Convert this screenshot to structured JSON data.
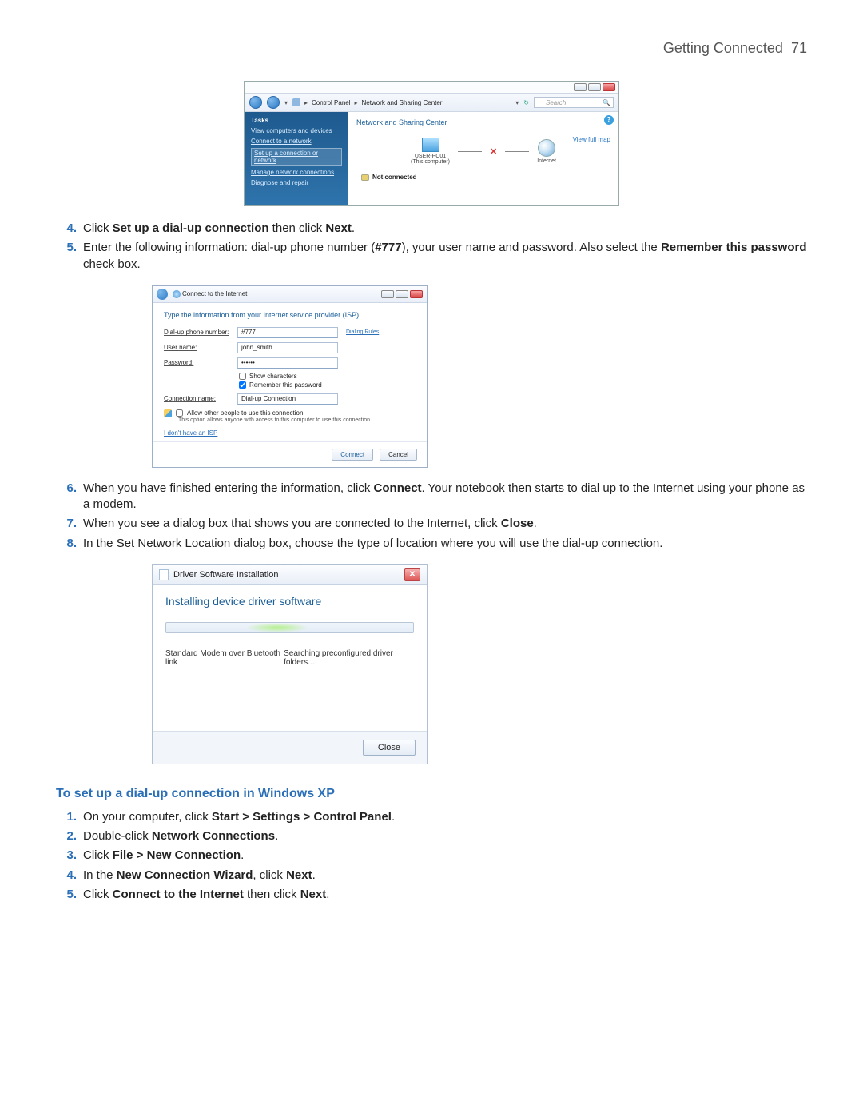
{
  "header": {
    "title": "Getting Connected",
    "page": "71"
  },
  "step4": {
    "pre": "Click ",
    "b1": "Set up a dial-up connection",
    "mid": " then click ",
    "b2": "Next",
    "post": "."
  },
  "step5": {
    "pre": "Enter the following information: dial-up phone number (",
    "b1": "#777",
    "mid": "), your user name and password. Also select the ",
    "b2": "Remember this password",
    "post": " check box."
  },
  "step6": {
    "pre": "When you have finished entering the information, click ",
    "b1": "Connect",
    "post": ". Your notebook then starts to dial up to the Internet using your phone as a modem."
  },
  "step7": {
    "pre": "When you see a dialog box that shows you are connected to the Internet, click ",
    "b1": "Close",
    "post": "."
  },
  "step8": {
    "text": "In the Set Network Location dialog box, choose the type of location where you will use the dial-up connection."
  },
  "nsc": {
    "breadcrumb": {
      "a": "Control Panel",
      "b": "Network and Sharing Center"
    },
    "search_placeholder": "Search",
    "tasks_title": "Tasks",
    "tasks": {
      "t1": "View computers and devices",
      "t2": "Connect to a network",
      "t3": "Set up a connection or network",
      "t4": "Manage network connections",
      "t5": "Diagnose and repair"
    },
    "heading": "Network and Sharing Center",
    "view_map": "View full map",
    "pc_name": "USER-PC01",
    "pc_sub": "(This computer)",
    "internet": "Internet",
    "status": "Not connected"
  },
  "wiz": {
    "title": "Connect to the Internet",
    "heading": "Type the information from your Internet service provider (ISP)",
    "l_phone": "Dial-up phone number:",
    "v_phone": "#777",
    "dialing_rules": "Dialing Rules",
    "l_user": "User name:",
    "v_user": "john_smith",
    "l_pass": "Password:",
    "v_pass": "••••••",
    "chk_show": "Show characters",
    "chk_remember": "Remember this password",
    "l_conn": "Connection name:",
    "v_conn": "Dial-up Connection",
    "allow": "Allow other people to use this connection",
    "allow_sub": "This option allows anyone with access to this computer to use this connection.",
    "no_isp": "I don't have an ISP",
    "btn_connect": "Connect",
    "btn_cancel": "Cancel"
  },
  "drv": {
    "title": "Driver Software Installation",
    "heading": "Installing device driver software",
    "device": "Standard Modem over Bluetooth link",
    "status": "Searching preconfigured driver folders...",
    "close": "Close"
  },
  "xp": {
    "heading": "To set up a dial-up connection in Windows XP",
    "s1": {
      "pre": "On your computer, click ",
      "b1": "Start > Settings > Control Panel",
      "post": "."
    },
    "s2": {
      "pre": "Double-click ",
      "b1": "Network Connections",
      "post": "."
    },
    "s3": {
      "pre": "Click ",
      "b1": "File > New Connection",
      "post": "."
    },
    "s4": {
      "pre": "In the ",
      "b1": "New Connection Wizard",
      "mid": ", click ",
      "b2": "Next",
      "post": "."
    },
    "s5": {
      "pre": "Click ",
      "b1": "Connect to the Internet",
      "mid": " then click ",
      "b2": "Next",
      "post": "."
    }
  }
}
